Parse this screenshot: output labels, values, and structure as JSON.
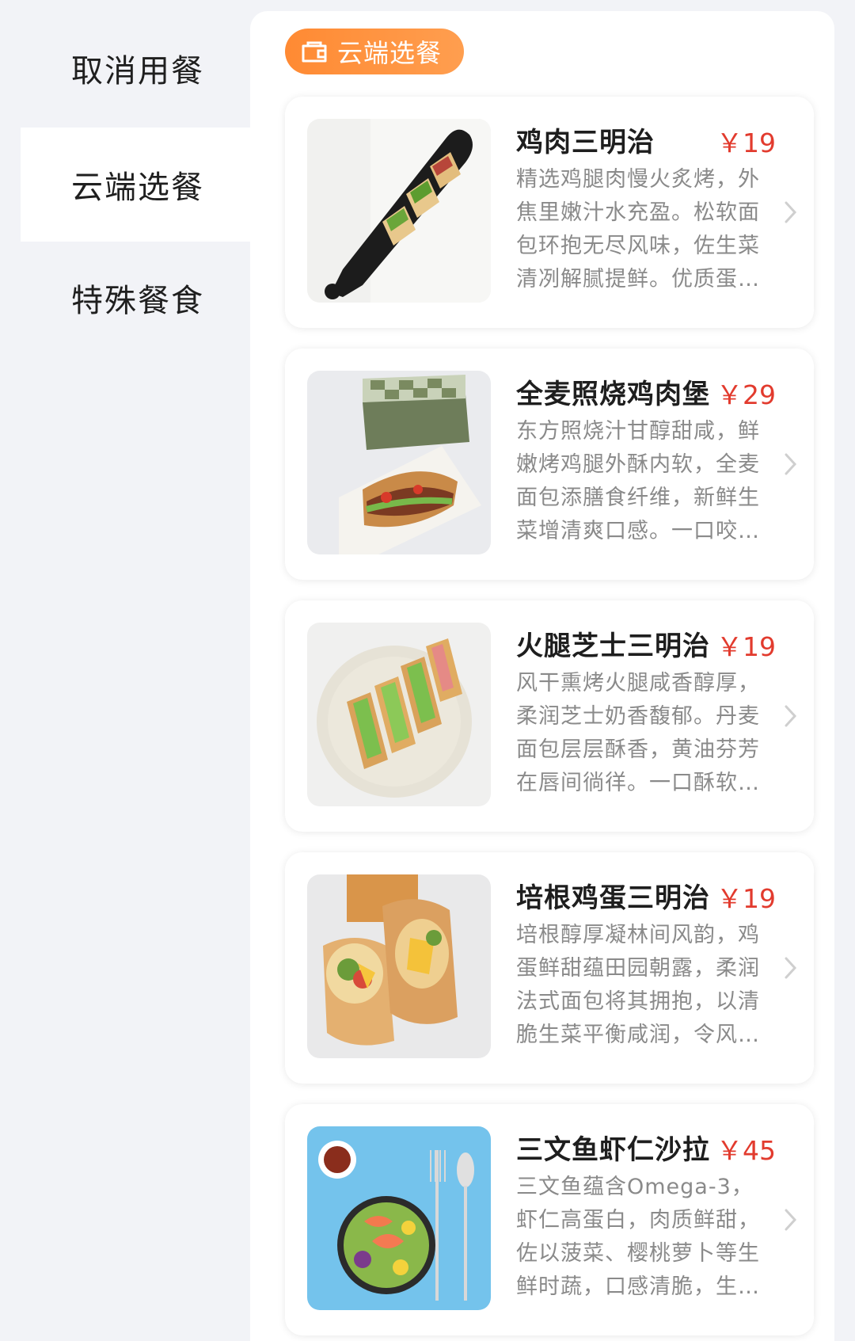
{
  "sidebar": {
    "items": [
      {
        "label": "取消用餐",
        "active": false
      },
      {
        "label": "云端选餐",
        "active": true
      },
      {
        "label": "特殊餐食",
        "active": false
      }
    ]
  },
  "section": {
    "label": "云端选餐",
    "icon": "bag-icon",
    "accent_color": "#ff8a33"
  },
  "price_color": "#e23b2e",
  "items": [
    {
      "title": "鸡肉三明治",
      "price": "￥19",
      "description": "精选鸡腿肉慢火炙烤，外焦里嫩汁水充盈。松软面包环抱无尽风味，佐生菜清冽解腻提鲜。优质蛋…",
      "image": "chicken-sandwich-photo"
    },
    {
      "title": "全麦照烧鸡肉堡",
      "price": "￥29",
      "description": "东方照烧汁甘醇甜咸，鲜嫩烤鸡腿外酥内软，全麦面包添膳食纤维，新鲜生菜增清爽口感。一口咬…",
      "image": "teriyaki-chicken-burger-photo"
    },
    {
      "title": "火腿芝士三明治",
      "price": "￥19",
      "description": "风干熏烤火腿咸香醇厚，柔润芝士奶香馥郁。丹麦面包层层酥香，黄油芬芳在唇间徜徉。一口酥软…",
      "image": "ham-cheese-sandwich-photo"
    },
    {
      "title": "培根鸡蛋三明治",
      "price": "￥19",
      "description": "培根醇厚凝林间风韵，鸡蛋鲜甜蕴田园朝露，柔润法式面包将其拥抱，以清脆生菜平衡咸润，令风…",
      "image": "bacon-egg-sandwich-photo"
    },
    {
      "title": "三文鱼虾仁沙拉",
      "price": "￥45",
      "description": "三文鱼蕴含Omega-3，虾仁高蛋白，肉质鲜甜，佐以菠菜、樱桃萝卜等生鲜时蔬，口感清脆，生机…",
      "image": "salmon-shrimp-salad-photo"
    }
  ]
}
